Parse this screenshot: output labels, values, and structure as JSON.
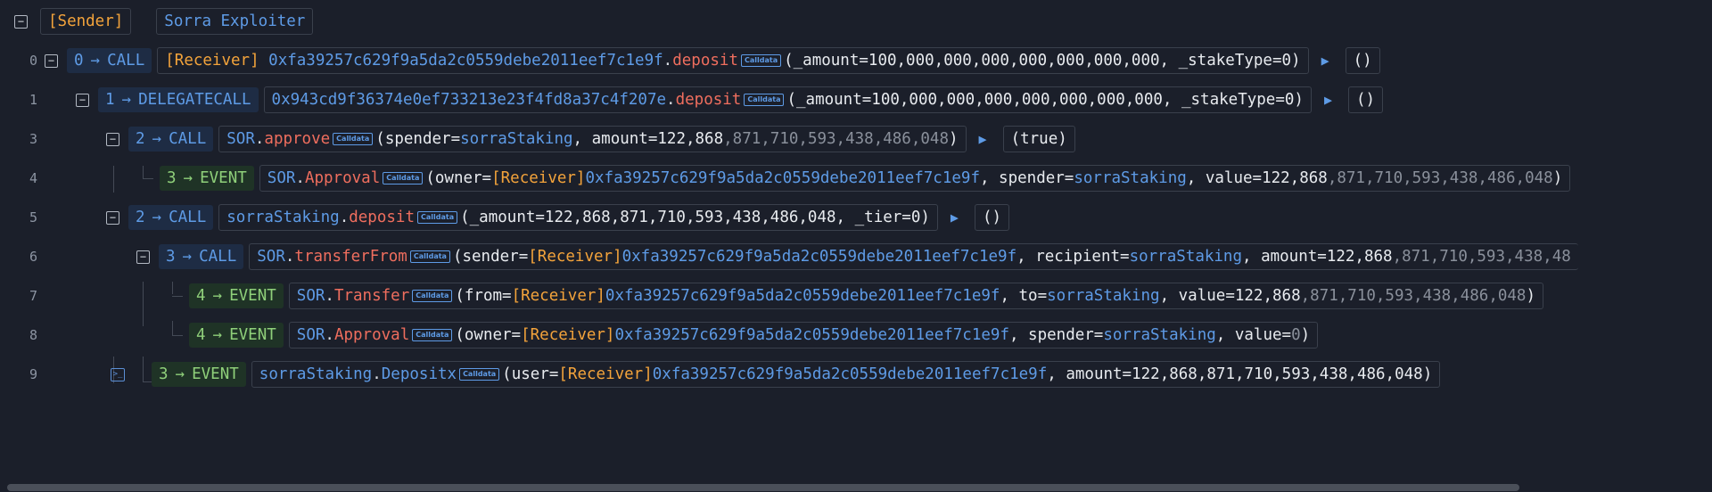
{
  "header": {
    "sender_tag": "[Sender]",
    "sender_name": "Sorra Exploiter"
  },
  "rows": [
    {
      "line": "0",
      "depth": "0",
      "type": "CALL",
      "addr_tag": "[Receiver]",
      "target": "0xfa39257c629f9a5da2c0559debe2011eef7c1e9f",
      "fn": "deposit",
      "calldata": "Calldata",
      "args": "(_amount=100,000,000,000,000,000,000,000, _stakeType=0)",
      "ret": "()"
    },
    {
      "line": "1",
      "depth": "1",
      "type": "DELEGATECALL",
      "target": "0x943cd9f36374e0ef733213e23f4fd8a37c4f207e",
      "fn": "deposit",
      "calldata": "Calldata",
      "args": "(_amount=100,000,000,000,000,000,000,000, _stakeType=0)",
      "ret": "()"
    },
    {
      "line": "3",
      "depth": "2",
      "type": "CALL",
      "target": "SOR",
      "fn": "approve",
      "calldata": "Calldata",
      "args_a": "(spender=",
      "arg_addr": "sorraStaking",
      "args_b": ", amount=122,868",
      "args_muted": ",871,710,593,438,486,048",
      "args_c": ")",
      "ret": "(true)"
    },
    {
      "line": "4",
      "depth": "3",
      "type": "EVENT",
      "target": "SOR",
      "fn": "Approval",
      "calldata": "Calldata",
      "args_a": "(owner=",
      "arg_tag": "[Receiver]",
      "arg_addr": "0xfa39257c629f9a5da2c0559debe2011eef7c1e9f",
      "args_b": ", spender=",
      "arg_addr2": "sorraStaking",
      "args_c": ", value=122,868",
      "args_muted": ",871,710,593,438,486,048",
      "args_d": ")"
    },
    {
      "line": "5",
      "depth": "2",
      "type": "CALL",
      "target": "sorraStaking",
      "fn": "deposit",
      "calldata": "Calldata",
      "args": "(_amount=122,868,871,710,593,438,486,048, _tier=0)",
      "ret": "()"
    },
    {
      "line": "6",
      "depth": "3",
      "type": "CALL",
      "target": "SOR",
      "fn": "transferFrom",
      "calldata": "Calldata",
      "args_a": "(sender=",
      "arg_tag": "[Receiver]",
      "arg_addr": "0xfa39257c629f9a5da2c0559debe2011eef7c1e9f",
      "args_b": ", recipient=",
      "arg_addr2": "sorraStaking",
      "args_c": ", amount=122,868",
      "args_muted": ",871,710,593,438,48"
    },
    {
      "line": "7",
      "depth": "4",
      "type": "EVENT",
      "target": "SOR",
      "fn": "Transfer",
      "calldata": "Calldata",
      "args_a": "(from=",
      "arg_tag": "[Receiver]",
      "arg_addr": "0xfa39257c629f9a5da2c0559debe2011eef7c1e9f",
      "args_b": ", to=",
      "arg_addr2": "sorraStaking",
      "args_c": ", value=122,868",
      "args_muted": ",871,710,593,438,486,048",
      "args_d": ")"
    },
    {
      "line": "8",
      "depth": "4",
      "type": "EVENT",
      "target": "SOR",
      "fn": "Approval",
      "calldata": "Calldata",
      "args_a": "(owner=",
      "arg_tag": "[Receiver]",
      "arg_addr": "0xfa39257c629f9a5da2c0559debe2011eef7c1e9f",
      "args_b": ", spender=",
      "arg_addr2": "sorraStaking",
      "args_c": ", value=",
      "args_muted": "0",
      "args_d": ")"
    },
    {
      "line": "9",
      "depth": "3",
      "type": "EVENT",
      "target": "sorraStaking",
      "fn": "Depositx",
      "calldata": "Calldata",
      "args_a": "(user=",
      "arg_tag": "[Receiver]",
      "arg_addr": "0xfa39257c629f9a5da2c0559debe2011eef7c1e9f",
      "args_b": ", amount=122,868,871,710,593,438,486,048)"
    }
  ],
  "icons": {
    "collapse": "minus-square-icon",
    "expand_result": "play-triangle-icon",
    "terminal": "terminal-icon",
    "arrow": "arrow-right-icon"
  },
  "colors": {
    "background": "#1b1f2a",
    "call": "#5e9be6",
    "event": "#8fd07a",
    "receiver": "#f3a33b",
    "function": "#ef6e5e"
  }
}
